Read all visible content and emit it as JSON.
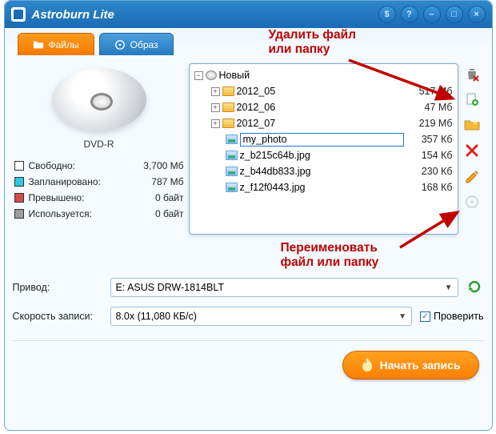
{
  "window": {
    "title": "Astroburn Lite"
  },
  "winbuttons": {
    "settings": "$",
    "help": "?",
    "min": "–",
    "max": "□",
    "close": "×"
  },
  "tabs": {
    "files": "Файлы",
    "image": "Образ"
  },
  "disc": {
    "type": "DVD-R"
  },
  "stats": {
    "free": {
      "label": "Свободно:",
      "value": "3,700 Мб",
      "color": "#ffffff"
    },
    "planned": {
      "label": "Запланировано:",
      "value": "787 Мб",
      "color": "#2bc9e6"
    },
    "over": {
      "label": "Превышено:",
      "value": "0 байт",
      "color": "#d84a4a"
    },
    "used": {
      "label": "Используется:",
      "value": "0 байт",
      "color": "#9c9c9c"
    }
  },
  "tree": {
    "root": {
      "name": "Новый",
      "size": ""
    },
    "items": [
      {
        "kind": "folder",
        "exp": "+",
        "name": "2012_05",
        "size": "517 Мб",
        "indent": 18
      },
      {
        "kind": "folder",
        "exp": "+",
        "name": "2012_06",
        "size": "47 Мб",
        "indent": 18
      },
      {
        "kind": "folder",
        "exp": "+",
        "name": "2012_07",
        "size": "219 Мб",
        "indent": 18
      },
      {
        "kind": "image",
        "exp": "",
        "name": "my_photo",
        "size": "357 Кб",
        "indent": 36,
        "editing": true
      },
      {
        "kind": "image",
        "exp": "",
        "name": "z_b215c64b.jpg",
        "size": "154 Кб",
        "indent": 36
      },
      {
        "kind": "image",
        "exp": "",
        "name": "z_b44db833.jpg",
        "size": "230 Кб",
        "indent": 36
      },
      {
        "kind": "image",
        "exp": "",
        "name": "z_f12f0443.jpg",
        "size": "168 Кб",
        "indent": 36
      }
    ]
  },
  "annotations": {
    "delete": "Удалить файл\nили папку",
    "rename": "Переименовать\nфайл или папку"
  },
  "controls": {
    "drive_label": "Привод:",
    "drive_value": "E: ASUS DRW-1814BLT",
    "speed_label": "Скорость записи:",
    "speed_value": "8.0x (11,080 КБ/с)",
    "verify_label": "Проверить",
    "verify_checked": true
  },
  "footer": {
    "burn": "Начать запись"
  }
}
